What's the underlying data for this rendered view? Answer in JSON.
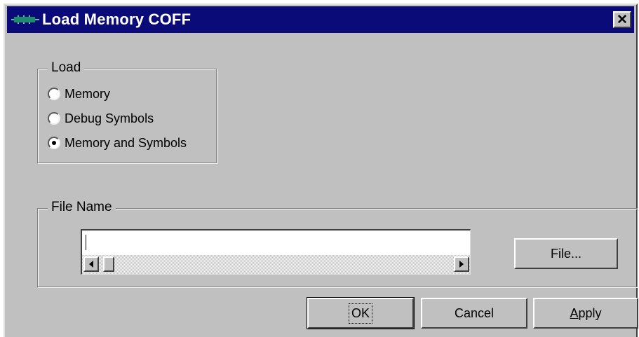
{
  "window": {
    "title": "Load Memory COFF",
    "close_glyph": "✕",
    "icon": "chip-icon"
  },
  "load_group": {
    "legend": "Load",
    "options": [
      {
        "label": "Memory",
        "checked": false
      },
      {
        "label": "Debug Symbols",
        "checked": false
      },
      {
        "label": "Memory and Symbols",
        "checked": true
      }
    ]
  },
  "file_group": {
    "legend": "File Name",
    "input_value": "",
    "file_button": "File..."
  },
  "buttons": {
    "ok": "OK",
    "cancel": "Cancel",
    "apply_prefix": "",
    "apply_mnemonic": "A",
    "apply_rest": "pply"
  },
  "colors": {
    "titlebar": "#0a0a78",
    "face": "#c0c0c0"
  }
}
